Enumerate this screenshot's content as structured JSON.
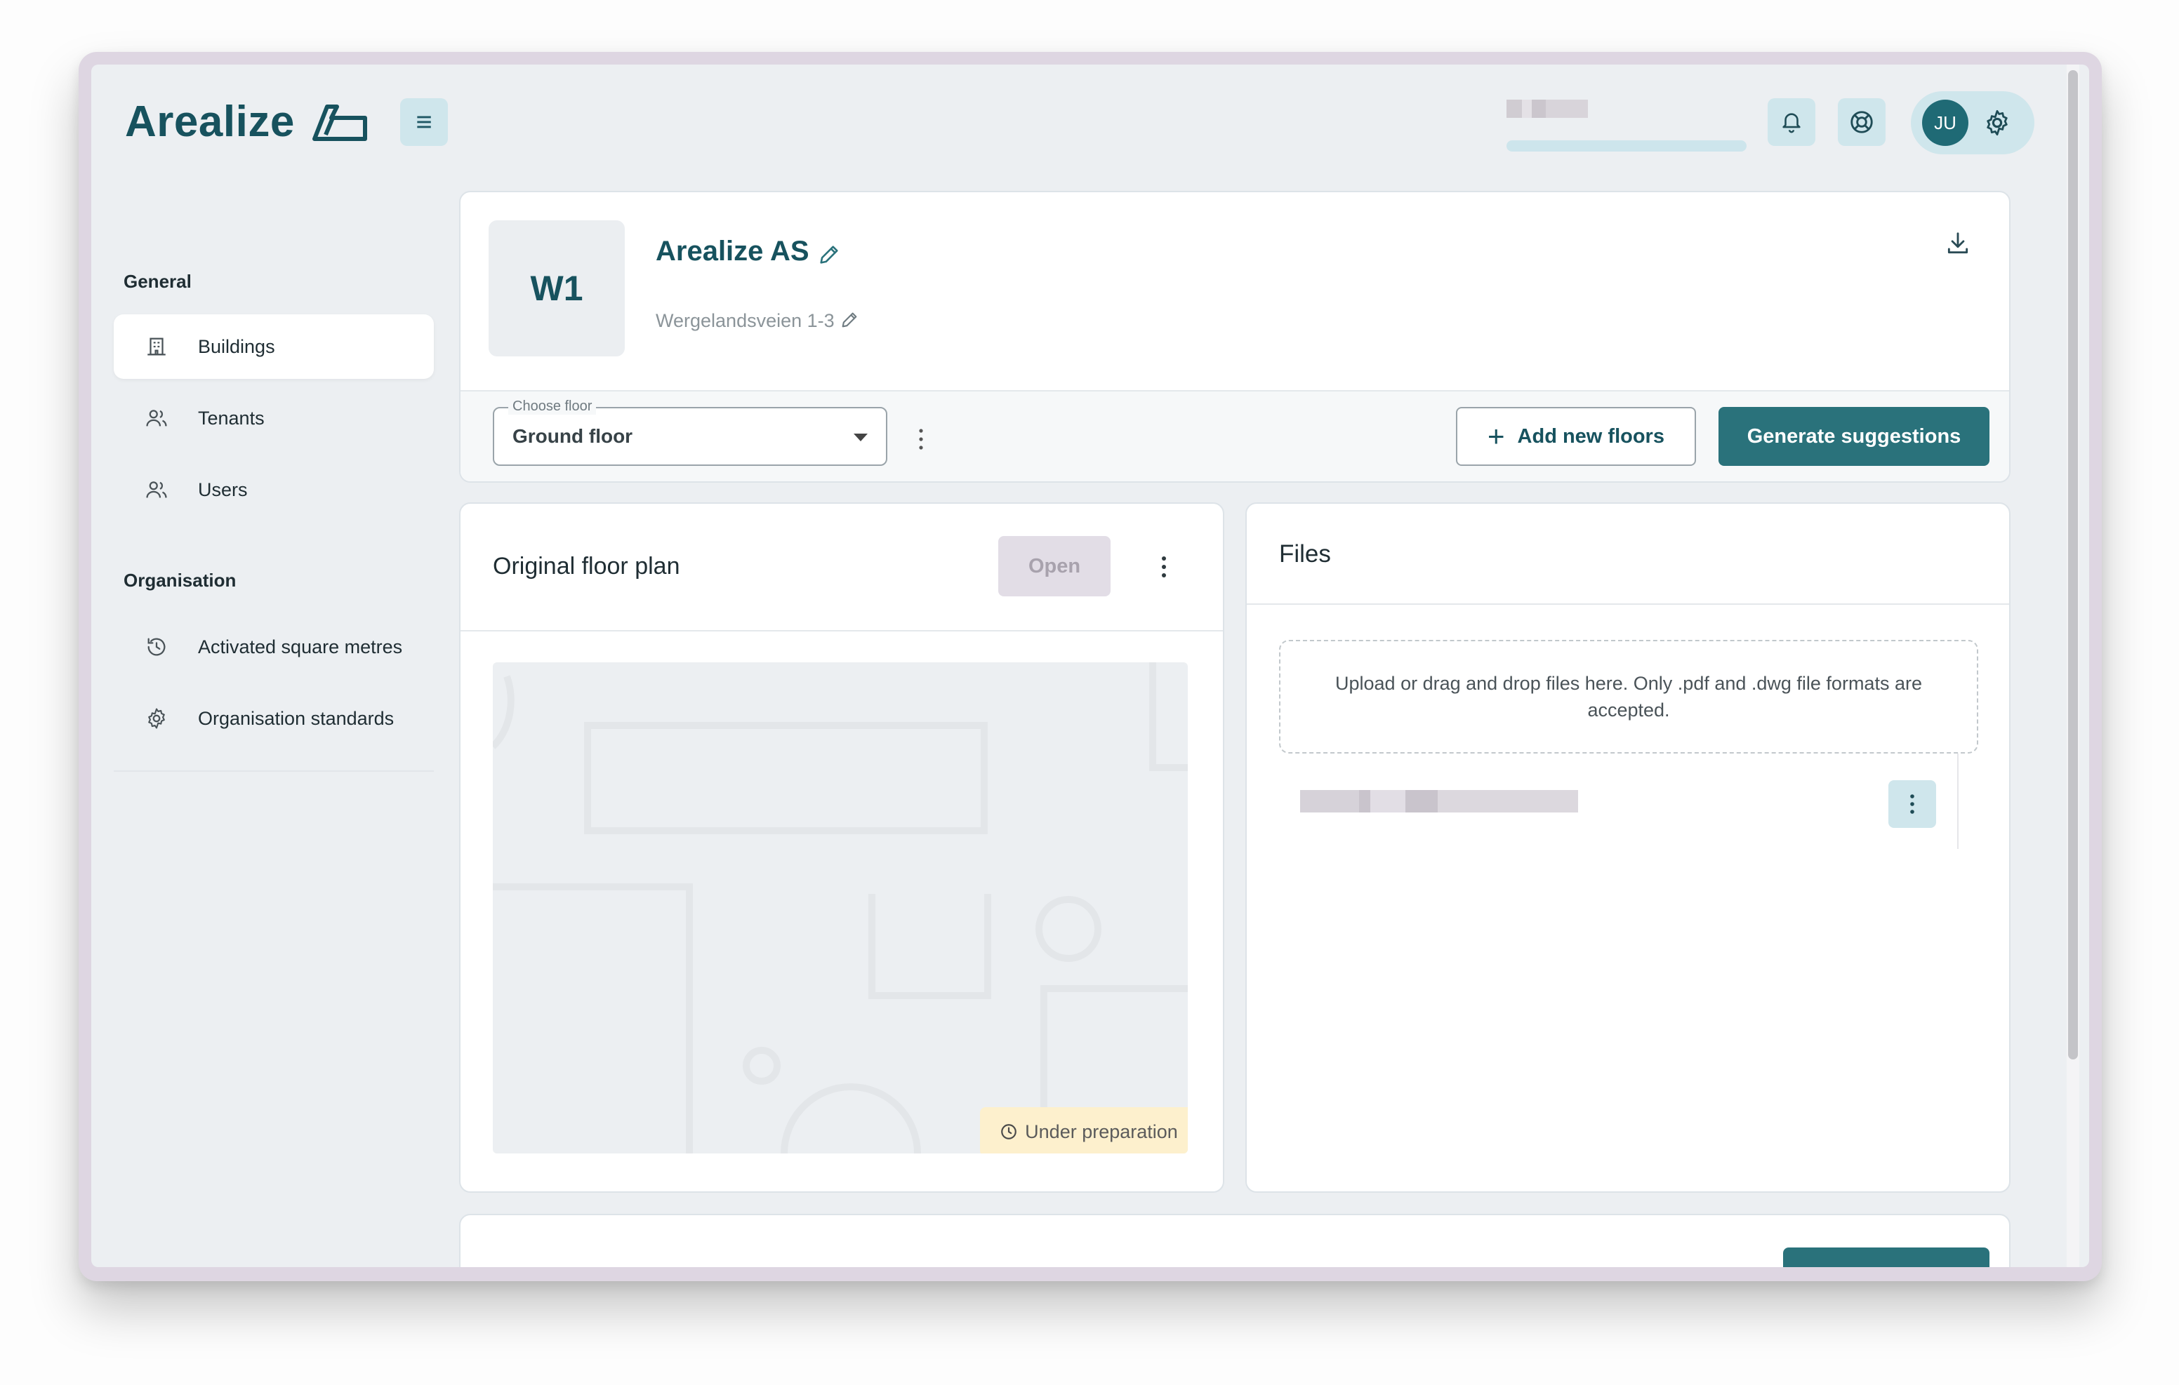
{
  "app": {
    "name": "Arealize"
  },
  "header": {
    "menu_icon": "hamburger-icon",
    "notifications_icon": "bell-icon",
    "help_icon": "lifebuoy-icon",
    "user_initials": "JU",
    "settings_icon": "gear-icon"
  },
  "sidebar": {
    "general_heading": "General",
    "general_items": [
      {
        "label": "Buildings",
        "icon": "building-icon",
        "active": true
      },
      {
        "label": "Tenants",
        "icon": "users-icon",
        "active": false
      },
      {
        "label": "Users",
        "icon": "users-icon",
        "active": false
      }
    ],
    "organisation_heading": "Organisation",
    "organisation_items": [
      {
        "label": "Activated square metres",
        "icon": "history-icon"
      },
      {
        "label": "Organisation standards",
        "icon": "gear-icon"
      }
    ]
  },
  "building": {
    "code": "W1",
    "name": "Arealize AS",
    "address": "Wergelandsveien 1-3"
  },
  "floor_bar": {
    "legend": "Choose floor",
    "selected_floor": "Ground floor",
    "add_floors_label": "Add new floors",
    "generate_label": "Generate suggestions"
  },
  "floor_plan": {
    "title": "Original floor plan",
    "open_label": "Open",
    "status": "Under preparation"
  },
  "files": {
    "title": "Files",
    "dropzone_text": "Upload or drag and drop files here. Only .pdf and .dwg file formats are accepted."
  },
  "colors": {
    "brand": "#17525e",
    "primary_button": "#2a727b",
    "icon_button_bg": "#cfe6ec",
    "badge_bg": "#fdf0cd"
  }
}
